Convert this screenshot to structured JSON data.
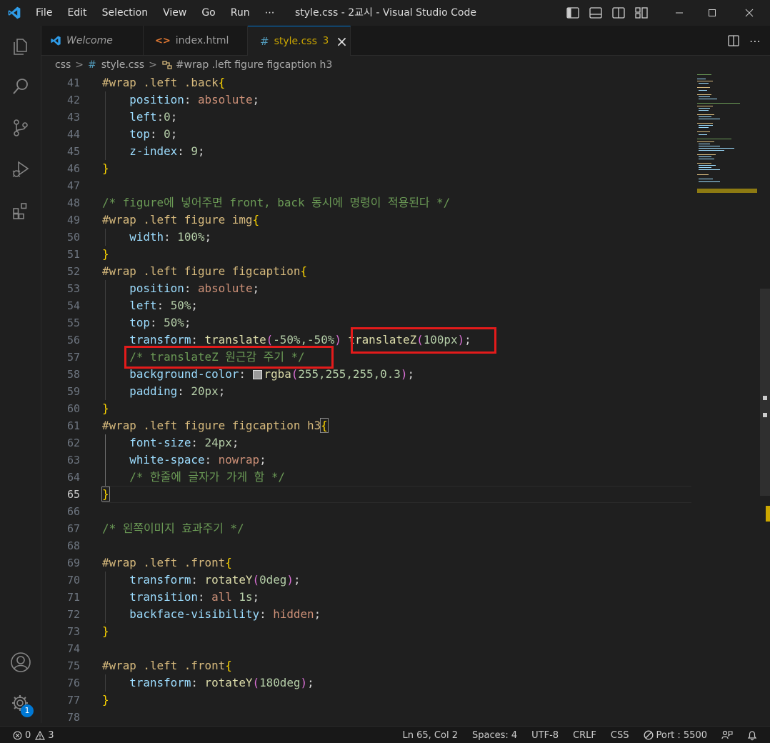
{
  "window": {
    "title": "style.css - 2교시 - Visual Studio Code",
    "menu": [
      "File",
      "Edit",
      "Selection",
      "View",
      "Go",
      "Run",
      "⋯"
    ]
  },
  "tabs": [
    {
      "label": "Welcome",
      "icon": "vscode-icon",
      "active": false
    },
    {
      "label": "index.html",
      "icon": "html-icon",
      "active": false
    },
    {
      "label": "style.css",
      "icon": "css-icon",
      "active": true,
      "badge": "3",
      "close": "×"
    }
  ],
  "breadcrumb": {
    "folder": "css",
    "file": "style.css",
    "file_icon": "#",
    "selector": "#wrap .left figure figcaption h3",
    "separator": ">"
  },
  "editor": {
    "current_line": 65,
    "lines": [
      {
        "n": "41"
      },
      {
        "n": "42"
      },
      {
        "n": "43"
      },
      {
        "n": "44"
      },
      {
        "n": "45"
      },
      {
        "n": "46"
      },
      {
        "n": "47"
      },
      {
        "n": "48"
      },
      {
        "n": "49"
      },
      {
        "n": "50"
      },
      {
        "n": "51"
      },
      {
        "n": "52"
      },
      {
        "n": "53"
      },
      {
        "n": "54"
      },
      {
        "n": "55"
      },
      {
        "n": "56"
      },
      {
        "n": "57"
      },
      {
        "n": "58"
      },
      {
        "n": "59"
      },
      {
        "n": "60"
      },
      {
        "n": "61"
      },
      {
        "n": "62"
      },
      {
        "n": "63"
      },
      {
        "n": "64"
      },
      {
        "n": "65"
      },
      {
        "n": "66"
      },
      {
        "n": "67"
      },
      {
        "n": "68"
      },
      {
        "n": "69"
      },
      {
        "n": "70"
      },
      {
        "n": "71"
      },
      {
        "n": "72"
      },
      {
        "n": "73"
      },
      {
        "n": "74"
      },
      {
        "n": "75"
      },
      {
        "n": "76"
      },
      {
        "n": "77"
      },
      {
        "n": "78"
      }
    ],
    "code": {
      "l41": {
        "sel": "#wrap .left .back",
        "open": "{"
      },
      "l42": {
        "prop": "position",
        "val": "absolute"
      },
      "l43": {
        "prop": "left",
        "val": "0"
      },
      "l44": {
        "prop": "top",
        "val": "0"
      },
      "l45": {
        "prop": "z-index",
        "val": "9"
      },
      "l46": {
        "close": "}"
      },
      "l48": {
        "comment": "/* figure에 넣어주면 front, back 동시에 명령이 적용된다 */"
      },
      "l49": {
        "sel": "#wrap .left figure img",
        "open": "{"
      },
      "l50": {
        "prop": "width",
        "val": "100%"
      },
      "l51": {
        "close": "}"
      },
      "l52": {
        "sel": "#wrap .left figure figcaption",
        "open": "{"
      },
      "l53": {
        "prop": "position",
        "val": "absolute"
      },
      "l54": {
        "prop": "left",
        "val": "50%"
      },
      "l55": {
        "prop": "top",
        "val": "50%"
      },
      "l56": {
        "prop": "transform",
        "fn1": "translate",
        "args1": "-50%,-50%",
        "fn2": "translateZ",
        "args2": "100px"
      },
      "l57": {
        "comment": "/* translateZ 원근감 주기 */"
      },
      "l58": {
        "prop": "background-color",
        "fn": "rgba",
        "args": "255,255,255,0.3"
      },
      "l59": {
        "prop": "padding",
        "val": "20px"
      },
      "l60": {
        "close": "}"
      },
      "l61": {
        "sel": "#wrap .left figure figcaption h3",
        "open": "{"
      },
      "l62": {
        "prop": "font-size",
        "val": "24px"
      },
      "l63": {
        "prop": "white-space",
        "val": "nowrap"
      },
      "l64": {
        "comment": "/* 한줄에 글자가 가게 함 */"
      },
      "l65": {
        "close": "}"
      },
      "l67": {
        "comment": "/* 왼쪽이미지 효과주기 */"
      },
      "l69": {
        "sel": "#wrap .left .front",
        "open": "{"
      },
      "l70": {
        "prop": "transform",
        "fn": "rotateY",
        "args": "0deg"
      },
      "l71": {
        "prop": "transition",
        "val1": "all",
        "val2": "1s"
      },
      "l72": {
        "prop": "backface-visibility",
        "val": "hidden"
      },
      "l73": {
        "close": "}"
      },
      "l75": {
        "sel": "#wrap .left .front",
        "open": "{"
      },
      "l76": {
        "prop": "transform",
        "fn": "rotateY",
        "args": "180deg"
      },
      "l77": {
        "close": "}"
      }
    }
  },
  "statusbar": {
    "errors": "0",
    "warnings": "3",
    "position": "Ln 65, Col 2",
    "spaces": "Spaces: 4",
    "encoding": "UTF-8",
    "eol": "CRLF",
    "language": "CSS",
    "port": "Port : 5500"
  },
  "accounts_badge": "1",
  "colors": {
    "accent": "#0078d4",
    "highlight_box": "#e31b1b",
    "selector": "#d7ba7d",
    "property": "#9cdcfe",
    "value": "#ce9178",
    "number": "#b5cea8",
    "function": "#dcdcaa",
    "comment": "#6a9955"
  }
}
